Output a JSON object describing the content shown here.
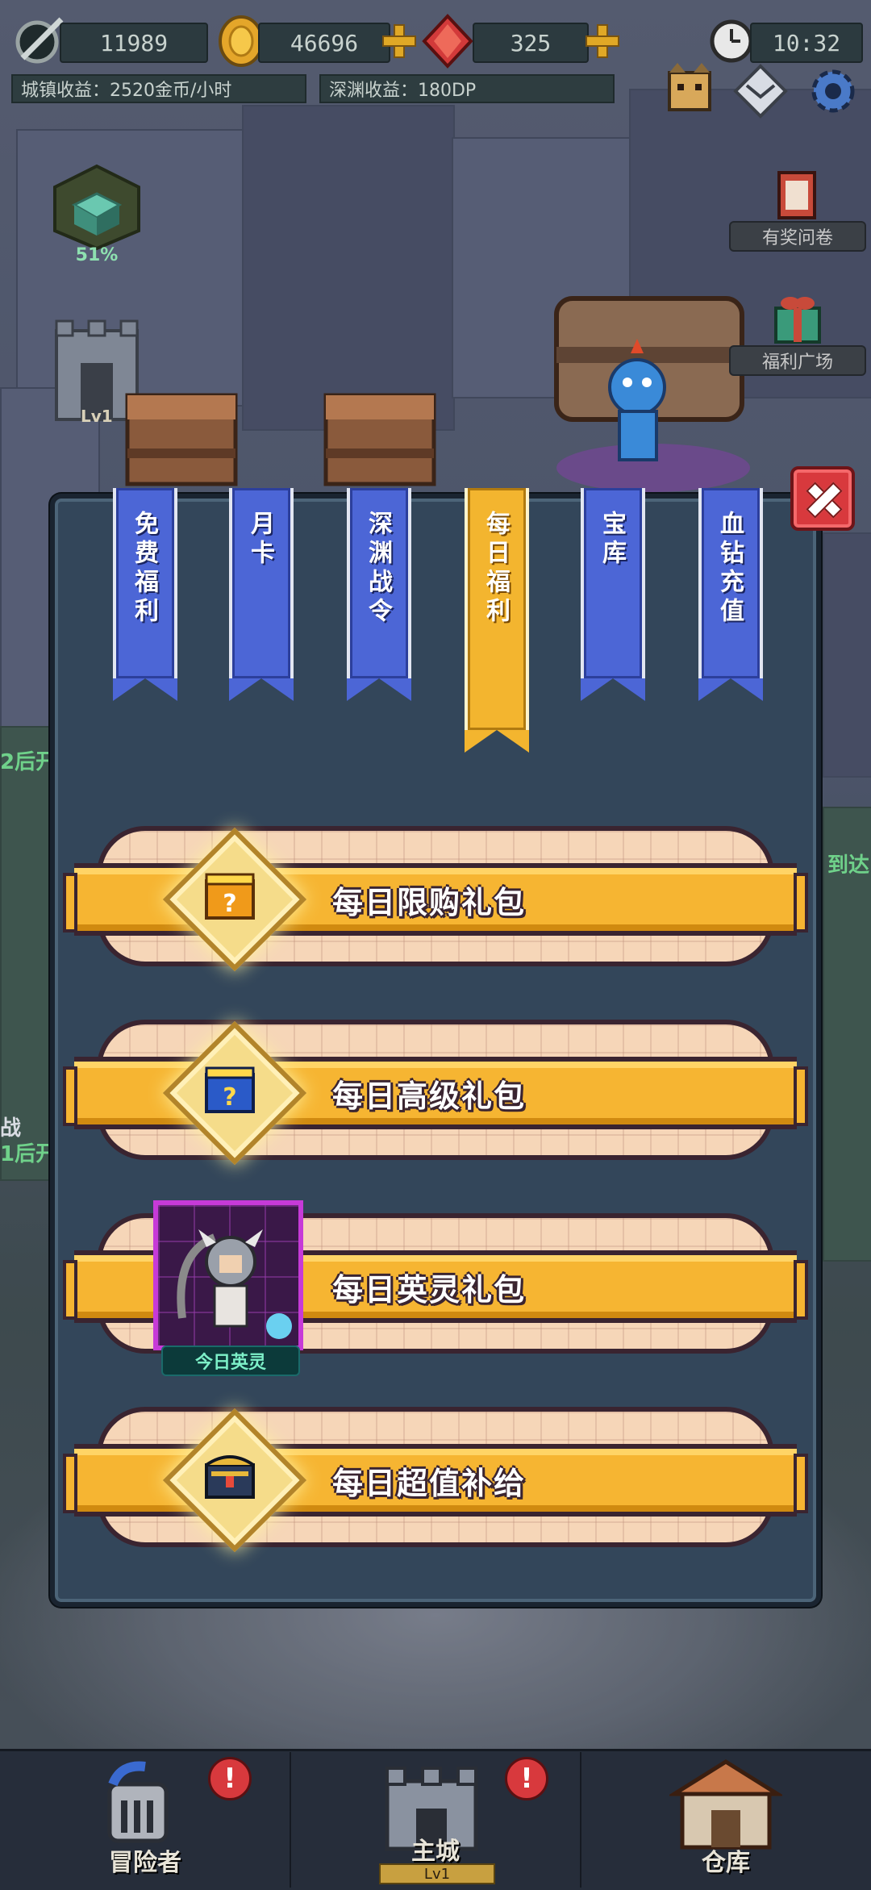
{
  "hud": {
    "power": "11989",
    "gold": "46696",
    "gems": "325",
    "clock": "10:32",
    "town_income": "城镇收益：2520金币/小时",
    "abyss_income": "深渊收益：180DP",
    "progress": "51%"
  },
  "widgets": {
    "survey_label": "有奖问卷",
    "welfare_label": "福利广场",
    "left_level": "Lv1"
  },
  "tabs": [
    {
      "label": "免费福利",
      "active": false
    },
    {
      "label": "月卡",
      "active": false
    },
    {
      "label": "深渊战令",
      "active": false
    },
    {
      "label": "每日福利",
      "active": true
    },
    {
      "label": "宝库",
      "active": false
    },
    {
      "label": "血钻充值",
      "active": false
    }
  ],
  "items": [
    {
      "label": "每日限购礼包",
      "icon": "orange-mystery-gift-icon"
    },
    {
      "label": "每日高级礼包",
      "icon": "blue-mystery-gift-icon"
    },
    {
      "label": "每日英灵礼包",
      "icon": "hero-portrait",
      "badge": "今日英灵"
    },
    {
      "label": "每日超值补给",
      "icon": "treasure-chest-icon"
    }
  ],
  "nav": {
    "adventurer": "冒险者",
    "main_city": "主城",
    "main_city_level": "Lv1",
    "warehouse": "仓库",
    "alert_mark": "!"
  },
  "colors": {
    "tab_blue": "#4c66d6",
    "tab_active": "#f3b52f",
    "dialog_bg": "#33465a",
    "close_red": "#d8393d",
    "rarity_purple": "#c63ad8"
  }
}
